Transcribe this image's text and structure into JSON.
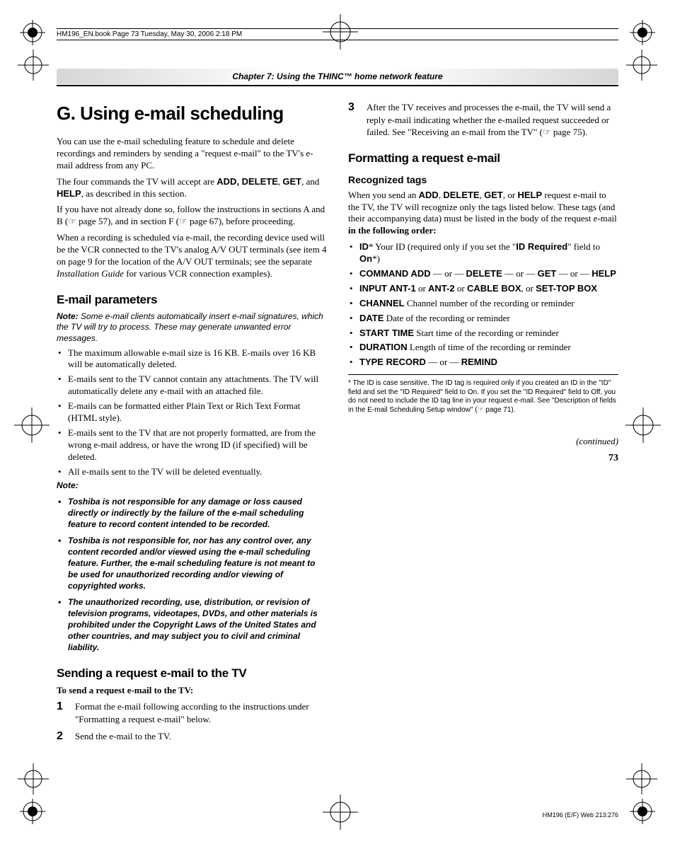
{
  "printmark": "HM196_EN.book  Page 73  Tuesday, May 30, 2006  2:18 PM",
  "chapterBar": "Chapter 7: Using the THINC™ home network feature",
  "left": {
    "h1": "G. Using e-mail scheduling",
    "p1": "You can use the e-mail scheduling feature to schedule and delete recordings and reminders by sending a \"request e-mail\" to the TV's e-mail address from any PC.",
    "p2a": "The four commands the TV will accept are ",
    "p2cmds": "ADD, DELETE",
    "p2b": ", ",
    "p2get": "GET",
    "p2c": ", and ",
    "p2help": "HELP",
    "p2d": ", as described in this section.",
    "p3": "If you have not already done so, follow the instructions in sections A and B (☞ page 57), and in section F (☞ page 67), before proceeding.",
    "p4a": "When a recording is scheduled via e-mail, the recording device used will be the VCR connected to the TV's analog A/V OUT terminals (see item 4 on page 9 for the location of the A/V OUT terminals; see the separate ",
    "p4i": "Installation Guide",
    "p4b": " for various VCR connection examples).",
    "h2a": "E-mail parameters",
    "note1": "Some e-mail clients automatically insert e-mail signatures, which the TV will try to process. These may generate unwanted error messages.",
    "bul": [
      "The maximum allowable e-mail size is 16 KB. E-mails over 16 KB will be automatically deleted.",
      "E-mails sent to the TV cannot contain any attachments. The TV will automatically delete any e-mail with an attached file.",
      "E-mails can be formatted either Plain Text or Rich Text Format (HTML style).",
      "E-mails sent to the TV that are not properly formatted, are from the wrong e-mail address, or have the wrong ID (if specified) will be deleted.",
      "All e-mails sent to the TV will be deleted eventually."
    ],
    "noteLabel": "Note:",
    "disc": [
      "Toshiba is not responsible for any damage or loss caused directly or indirectly by the failure of the e-mail scheduling feature to record content intended to be recorded.",
      "Toshiba is not responsible for, nor has any control over, any content recorded and/or viewed using the e-mail scheduling feature. Further, the e-mail scheduling feature is not meant to be used for unauthorized recording and/or viewing of copyrighted works.",
      "The unauthorized recording, use, distribution, or revision of television programs, videotapes, DVDs, and other materials is prohibited under the Copyright Laws of the United States and other countries, and may subject you to civil and criminal liability."
    ],
    "h2b": "Sending a request e-mail to the TV",
    "lead": "To send a request e-mail to the TV:",
    "steps": [
      "Format the e-mail following according to the instructions under \"Formatting a request e-mail\" below.",
      "Send the e-mail to the TV."
    ]
  },
  "right": {
    "step3": "After the TV receives and processes the e-mail, the TV will send a reply e-mail indicating whether the e-mailed request succeeded or failed. See \"Receiving an e-mail from the TV\" (☞ page 75).",
    "h2": "Formatting a request e-mail",
    "h3": "Recognized tags",
    "intro_a": "When you send an ",
    "intro_add": "ADD",
    "intro_c1": ", ",
    "intro_del": "DELETE",
    "intro_c2": ", ",
    "intro_get": "GET",
    "intro_c3": ", or ",
    "intro_help": "HELP",
    "intro_b": " request e-mail to the TV, the TV will recognize only the tags listed below. These tags (and their accompanying data) must be listed in the body of the request e-mail ",
    "intro_bold": "in the following order:",
    "tags": {
      "id_lbl": "ID",
      "id_txt_a": "*   Your ID (required only if you set the \"",
      "id_req": "ID Required",
      "id_txt_b": "\" field to ",
      "id_on": "On",
      "id_txt_c": "*)",
      "cmd_lbl": "COMMAND   ADD",
      "cmd_mid1": " — or — ",
      "cmd_del": "DELETE",
      "cmd_mid2": " — or — ",
      "cmd_get": "GET",
      "cmd_mid3": " — or — ",
      "cmd_help": "HELP",
      "inp_lbl": "INPUT   ANT-1",
      "inp_or1": " or ",
      "inp_ant2": "ANT-2",
      "inp_or2": " or ",
      "inp_cable": "CABLE BOX",
      "inp_or3": ", or ",
      "inp_stb": "SET-TOP BOX",
      "ch_lbl": "CHANNEL",
      "ch_txt": "   Channel number of the recording or reminder",
      "date_lbl": "DATE",
      "date_txt": "   Date of the recording or reminder",
      "st_lbl": "START TIME",
      "st_txt": "   Start time of the recording or reminder",
      "dur_lbl": "DURATION",
      "dur_txt": "   Length of time of the recording or reminder",
      "type_lbl": "TYPE   RECORD",
      "type_or": " — or — ",
      "type_rem": "REMIND"
    },
    "footnote": "*  The ID is case sensitive. The ID tag is required only if you created an ID in the \"ID\" field and set the \"ID Required\" field to On. If you set the \"ID Required\" field to Off, you do not need to include the ID tag line in your request e-mail. See \"Description of fields in the E-mail Scheduling Setup window\" (☞ page 71).",
    "continued": "(continued)"
  },
  "pageNum": "73",
  "footer": "HM196 (E/F) Web 213:276"
}
